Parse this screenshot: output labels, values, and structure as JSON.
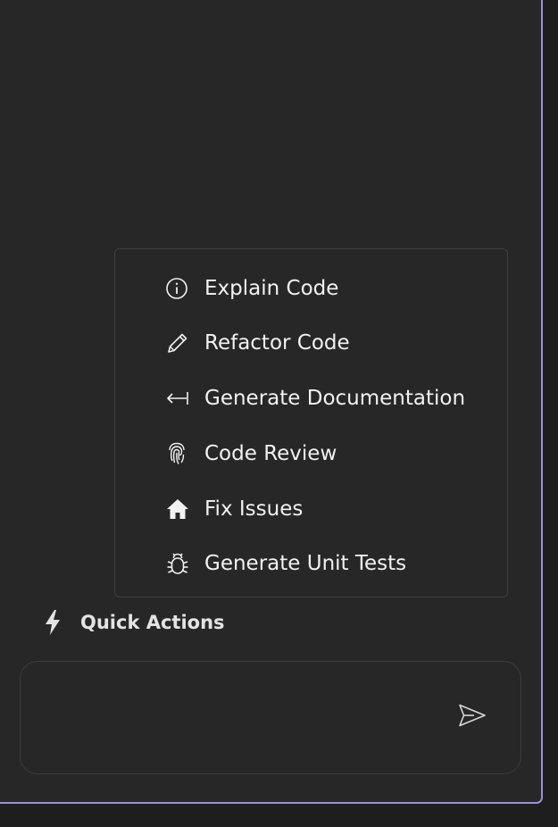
{
  "menu": {
    "items": [
      {
        "label": "Explain Code",
        "icon": "info-icon"
      },
      {
        "label": "Refactor Code",
        "icon": "pencil-icon"
      },
      {
        "label": "Generate Documentation",
        "icon": "arrow-left-bar-icon"
      },
      {
        "label": "Code Review",
        "icon": "fingerprint-icon"
      },
      {
        "label": "Fix Issues",
        "icon": "home-icon"
      },
      {
        "label": "Generate Unit Tests",
        "icon": "bug-icon"
      }
    ]
  },
  "quick_actions": {
    "label": "Quick Actions",
    "icon": "lightning-icon"
  },
  "chat_input": {
    "value": "",
    "placeholder": ""
  },
  "colors": {
    "panel_border": "#9b8fd4",
    "panel_bg": "#272727",
    "text": "#f2f2f2"
  }
}
